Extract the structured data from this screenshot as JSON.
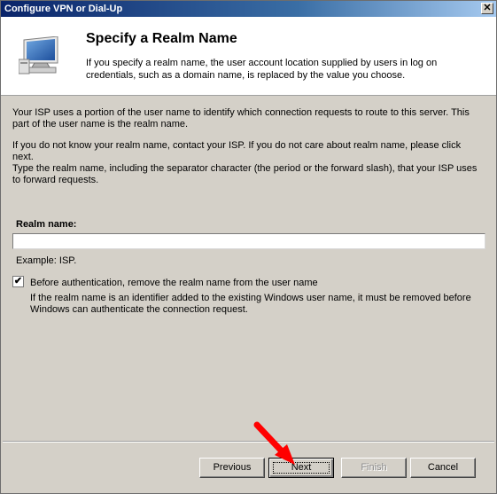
{
  "window": {
    "title": "Configure VPN or Dial-Up",
    "close_glyph": "✕"
  },
  "header": {
    "title": "Specify a Realm Name",
    "description": "If you specify a realm name, the user account location supplied by users in log on credentials, such as a domain name, is replaced by the value you choose.",
    "icon": "network-monitor-icon"
  },
  "body": {
    "paragraph1": "Your ISP uses a portion of the user name to identify which connection requests to route to this server. This part of the user name is the realm name.",
    "paragraph2": "If you do not know your realm name, contact your ISP. If you do not care about realm name, please click next.",
    "paragraph3": "Type the realm name, including the separator character (the period or the forward slash), that your ISP uses to forward requests."
  },
  "realm": {
    "label": "Realm name:",
    "value": "",
    "example": "Example: ISP."
  },
  "option": {
    "checked": true,
    "label": "Before authentication, remove the realm name from the user name",
    "description": "If the realm name is an identifier added to the existing Windows user name, it must be removed before Windows can authenticate the connection request."
  },
  "buttons": {
    "previous": "Previous",
    "next": "Next",
    "finish": "Finish",
    "cancel": "Cancel"
  },
  "annotation": {
    "arrow_color": "#ff0000"
  }
}
